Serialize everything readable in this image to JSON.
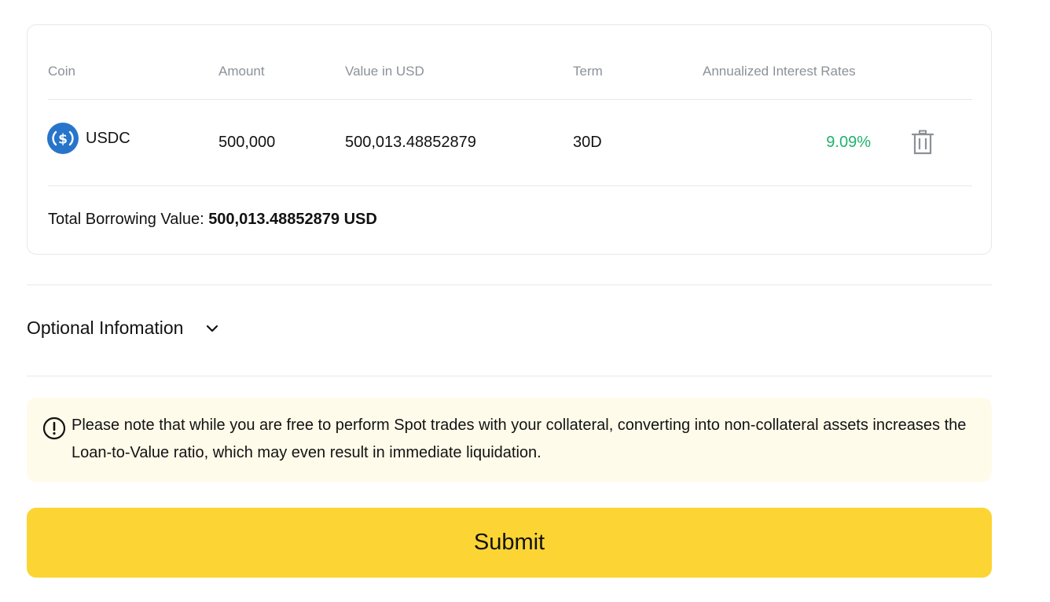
{
  "table": {
    "headers": {
      "coin": "Coin",
      "amount": "Amount",
      "value_usd": "Value in USD",
      "term": "Term",
      "rate": "Annualized Interest Rates"
    },
    "rows": [
      {
        "coin": "USDC",
        "coin_icon": "usdc-coin-icon",
        "amount": "500,000",
        "value_usd": "500,013.48852879",
        "term": "30D",
        "rate": "9.09%"
      }
    ],
    "total_label": "Total Borrowing Value:",
    "total_value": "500,013.48852879 USD"
  },
  "optional": {
    "label": "Optional Infomation"
  },
  "notice": {
    "text": "Please note that while you are free to perform Spot trades with your collateral, converting into non-collateral assets increases the Loan-to-Value ratio, which may even result in immediate liquidation."
  },
  "submit": {
    "label": "Submit"
  },
  "colors": {
    "accent_yellow": "#fcd535",
    "rate_green": "#20b26c",
    "notice_bg": "#fffbea",
    "usdc_blue": "#2775ca"
  }
}
